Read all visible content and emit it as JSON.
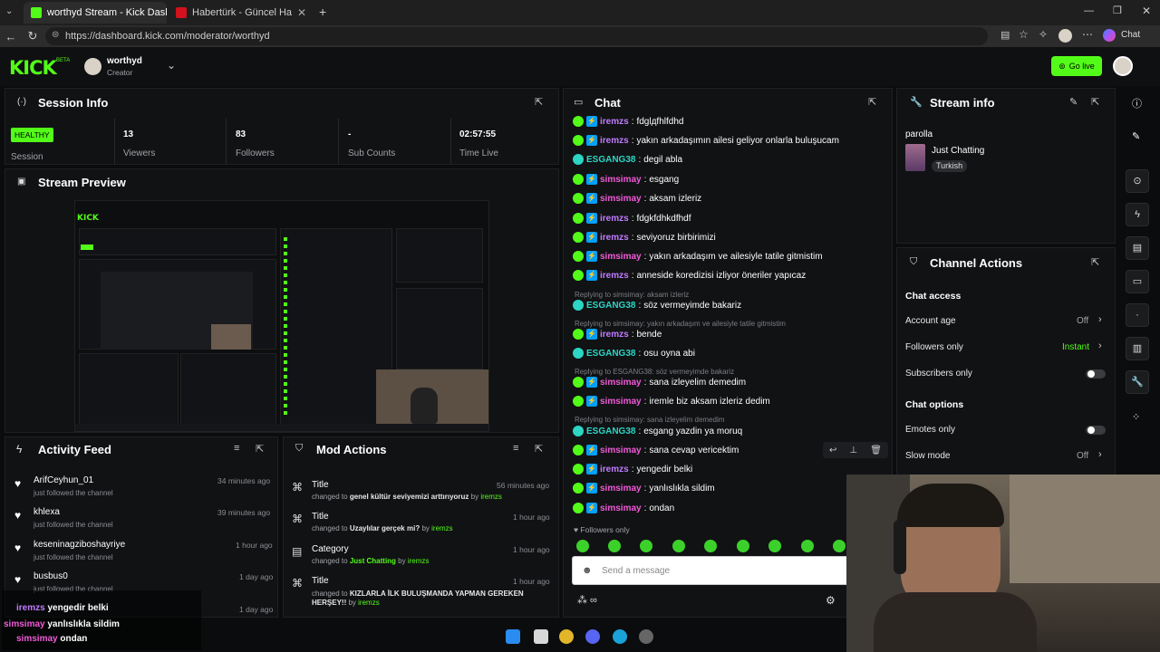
{
  "tabs": [
    {
      "title": "worthyd Stream - Kick Dashboard",
      "active": true
    },
    {
      "title": "Habertürk - Güncel Haberler, Son D",
      "active": false
    }
  ],
  "url": "https://dashboard.kick.com/moderator/worthyd",
  "browser_right": {
    "chat_label": "Chat"
  },
  "header": {
    "logo": "KICK",
    "beta": "BETA",
    "user_name": "worthyd",
    "user_role": "Creator",
    "go_live": "Go live"
  },
  "session": {
    "title": "Session Info",
    "status": "HEALTHY",
    "status_label": "Session",
    "stats": [
      {
        "value": "13",
        "label": "Viewers"
      },
      {
        "value": "83",
        "label": "Followers"
      },
      {
        "value": "-",
        "label": "Sub Counts"
      },
      {
        "value": "02:57:55",
        "label": "Time Live"
      }
    ]
  },
  "preview": {
    "title": "Stream Preview"
  },
  "activity": {
    "title": "Activity Feed",
    "items": [
      {
        "name": "ArifCeyhun_01",
        "sub": "just followed the channel",
        "time": "34 minutes ago"
      },
      {
        "name": "khlexa",
        "sub": "just followed the channel",
        "time": "39 minutes ago"
      },
      {
        "name": "keseninagziboshayriye",
        "sub": "just followed the channel",
        "time": "1 hour ago"
      },
      {
        "name": "busbus0",
        "sub": "just followed the channel",
        "time": "1 day ago"
      },
      {
        "name": "",
        "sub": "",
        "time": "1 day ago"
      }
    ]
  },
  "mod": {
    "title": "Mod Actions",
    "items": [
      {
        "type": "Title",
        "time": "56 minutes ago",
        "pre": "changed to",
        "value": "genel kültür seviyemizi arttırıyoruz",
        "by": "by",
        "user": "iremzs"
      },
      {
        "type": "Title",
        "time": "1 hour ago",
        "pre": "changed to",
        "value": "Uzaylılar gerçek mi?",
        "by": "by",
        "user": "iremzs"
      },
      {
        "type": "Category",
        "time": "1 hour ago",
        "pre": "changed to",
        "value": "Just Chatting",
        "by": "by",
        "user": "iremzs"
      },
      {
        "type": "Title",
        "time": "1 hour ago",
        "pre": "changed to",
        "value": "KIZLARLA İLK BULUŞMANDA YAPMAN GEREKEN HERŞEY!!",
        "by": "by",
        "user": "iremzs"
      }
    ]
  },
  "chat": {
    "title": "Chat",
    "messages": [
      {
        "user": "iremzs",
        "text": "fdglдfhlfdhd",
        "color": "lilac"
      },
      {
        "user": "iremzs",
        "text": "yakın arkadaşımın ailesi geliyor onlarla buluşucam",
        "color": "lilac"
      },
      {
        "user": "ESGANG38",
        "text": "degil abla",
        "color": "teal"
      },
      {
        "user": "simsimay",
        "text": "esgang",
        "color": "pink"
      },
      {
        "user": "simsimay",
        "text": "aksam izleriz",
        "color": "pink"
      },
      {
        "user": "iremzs",
        "text": "fdgkfdhkdfhdf",
        "color": "lilac"
      },
      {
        "user": "iremzs",
        "text": "seviyoruz birbirimizi",
        "color": "lilac"
      },
      {
        "user": "simsimay",
        "text": "yakın arkadaşım ve ailesiyle tatile gitmistim",
        "color": "pink"
      },
      {
        "user": "iremzs",
        "text": "anneside koredizisi izliyor öneriler yapıcaz",
        "color": "lilac"
      },
      {
        "user": "ESGANG38",
        "text": "söz vermeyimde bakariz",
        "color": "teal"
      },
      {
        "user": "iremzs",
        "text": "bende",
        "color": "lilac"
      },
      {
        "user": "ESGANG38",
        "text": "osu oyna abi",
        "color": "teal"
      },
      {
        "user": "simsimay",
        "text": "sana izleyelim demedim",
        "color": "pink"
      },
      {
        "user": "simsimay",
        "text": "iremle biz aksam izleriz dedim",
        "color": "pink"
      },
      {
        "user": "ESGANG38",
        "text": "esgang yazdin ya moruq",
        "color": "teal"
      },
      {
        "user": "simsimay",
        "text": "sana cevap vericektim",
        "color": "pink"
      },
      {
        "user": "iremzs",
        "text": "yengedir belki",
        "color": "lilac"
      },
      {
        "user": "simsimay",
        "text": "yanlıslıkla sildim",
        "color": "pink"
      },
      {
        "user": "simsimay",
        "text": "ondan",
        "color": "pink"
      }
    ],
    "replies": [
      "Replying to simsimay: aksam izleriz",
      "Replying to simsimay: yakın arkadaşım ve ailesiyle tatile gitmistim",
      "Replying to ESGANG38: söz vermeyimde bakariz",
      "Replying to simsimay: sana izleyelim demedim"
    ],
    "followers_only": "Followers only",
    "placeholder": "Send a message"
  },
  "stream_info": {
    "title": "Stream info",
    "stream_title": "parolla",
    "category": "Just Chatting",
    "language": "Turkish"
  },
  "channel_actions": {
    "title": "Channel Actions",
    "chat_access": "Chat access",
    "account_age": {
      "label": "Account age",
      "value": "Off"
    },
    "followers_only": {
      "label": "Followers only",
      "value": "Instant"
    },
    "subscribers_only": {
      "label": "Subscribers only"
    },
    "chat_options": "Chat options",
    "emotes_only": {
      "label": "Emotes only"
    },
    "slow_mode": {
      "label": "Slow mode",
      "value": "Off"
    }
  },
  "overlay_chat": [
    {
      "user": "iremzs",
      "text": "yengedir belki"
    },
    {
      "user": "simsimay",
      "text": "yanlıslıkla sildim"
    },
    {
      "user": "simsimay",
      "text": "ondan"
    }
  ],
  "colors": {
    "kick_green": "#53fc18",
    "background": "#0b0c0d",
    "panel": "#111214"
  }
}
